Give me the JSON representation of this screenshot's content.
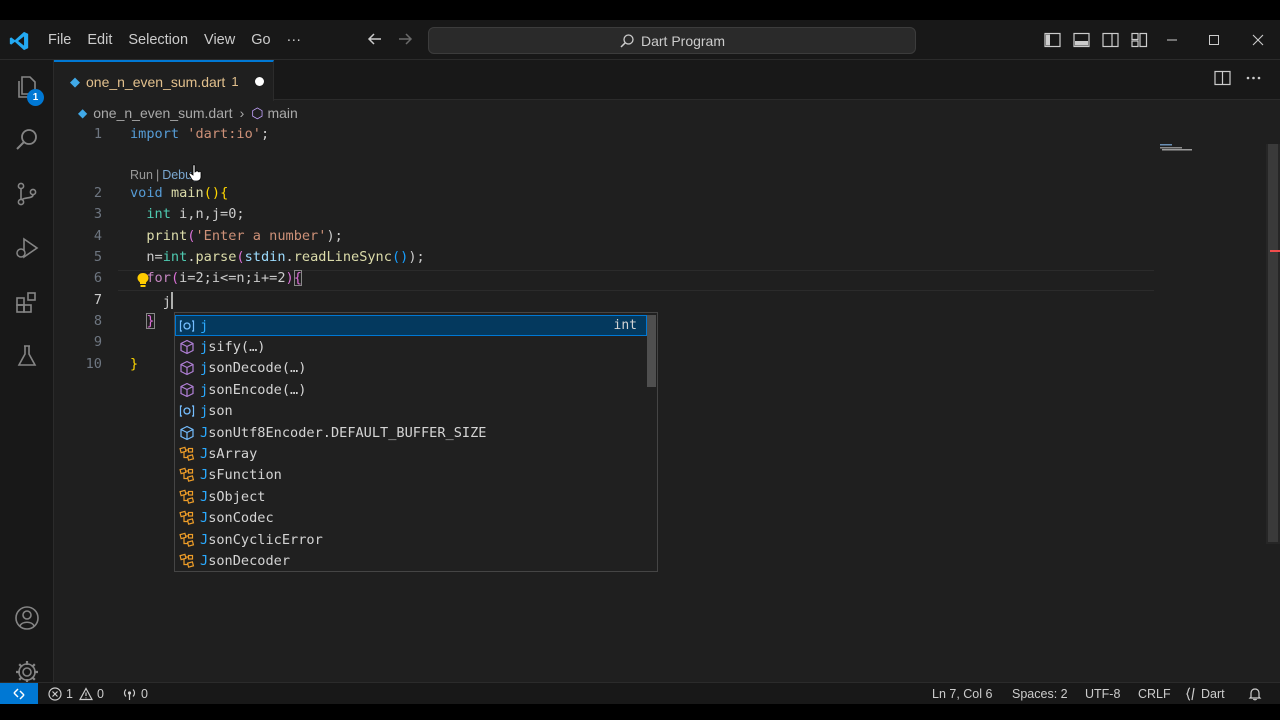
{
  "menu": [
    "File",
    "Edit",
    "Selection",
    "View",
    "Go",
    "···"
  ],
  "command_center": {
    "label": "Dart Program"
  },
  "activity": {
    "explorer_badge": "1"
  },
  "tab": {
    "filename": "one_n_even_sum.dart",
    "problem_count": "1"
  },
  "breadcrumb": {
    "file": "one_n_even_sum.dart",
    "symbol": "main"
  },
  "codelens": {
    "run": "Run",
    "separator": "|",
    "debug": "Debug"
  },
  "editor": {
    "line_numbers": [
      "1",
      "2",
      "3",
      "4",
      "5",
      "6",
      "7",
      "8",
      "9",
      "10"
    ],
    "lines": {
      "l1": {
        "import_kw": "import",
        "uri": "'dart:io'",
        "semi": ";"
      },
      "l2": {
        "void_kw": "void",
        "name": "main",
        "paren": "()",
        "brace": "{"
      },
      "l3": {
        "type": "int",
        "vars": "i,n,j=0;"
      },
      "l4": {
        "fn": "print",
        "open": "(",
        "arg": "'Enter a number'",
        "close": ");"
      },
      "l5": {
        "lhs": "n=",
        "type": "int",
        "dot": ".",
        "fn": "parse",
        "open": "(",
        "obj": "stdin",
        "dot2": ".",
        "fn2": "readLineSync",
        "inner": "()",
        "close": ");"
      },
      "l6": {
        "kw": "for",
        "open": "(",
        "cond": "i=2;i<=n;i+=2",
        "close": ")",
        "brace": "{"
      },
      "l7": {
        "typed": "j"
      },
      "l8": {
        "brace": "}"
      },
      "l10": {
        "brace": "}"
      }
    }
  },
  "suggestions": [
    {
      "kind": "variable",
      "match": "j",
      "rest": "",
      "detail": "int",
      "selected": true
    },
    {
      "kind": "method",
      "match": "j",
      "rest": "sify(…)",
      "detail": "",
      "selected": false
    },
    {
      "kind": "method",
      "match": "j",
      "rest": "sonDecode(…)",
      "detail": "",
      "selected": false
    },
    {
      "kind": "method",
      "match": "j",
      "rest": "sonEncode(…)",
      "detail": "",
      "selected": false
    },
    {
      "kind": "variable",
      "match": "j",
      "rest": "son",
      "detail": "",
      "selected": false
    },
    {
      "kind": "field",
      "match": "J",
      "rest": "sonUtf8Encoder.DEFAULT_BUFFER_SIZE",
      "detail": "",
      "selected": false
    },
    {
      "kind": "class",
      "match": "J",
      "rest": "sArray",
      "detail": "",
      "selected": false
    },
    {
      "kind": "class",
      "match": "J",
      "rest": "sFunction",
      "detail": "",
      "selected": false
    },
    {
      "kind": "class",
      "match": "J",
      "rest": "sObject",
      "detail": "",
      "selected": false
    },
    {
      "kind": "class",
      "match": "J",
      "rest": "sonCodec",
      "detail": "",
      "selected": false
    },
    {
      "kind": "class",
      "match": "J",
      "rest": "sonCyclicError",
      "detail": "",
      "selected": false
    },
    {
      "kind": "class",
      "match": "J",
      "rest": "sonDecoder",
      "detail": "",
      "selected": false
    }
  ],
  "statusbar": {
    "errors": "1",
    "warnings": "0",
    "ports": "0",
    "position": "Ln 7, Col 6",
    "spaces": "Spaces: 2",
    "encoding": "UTF-8",
    "eol": "CRLF",
    "language": "Dart"
  },
  "colors": {
    "accent": "#0078d4",
    "selection": "#04395e",
    "match_highlight": "#2aaaff"
  }
}
